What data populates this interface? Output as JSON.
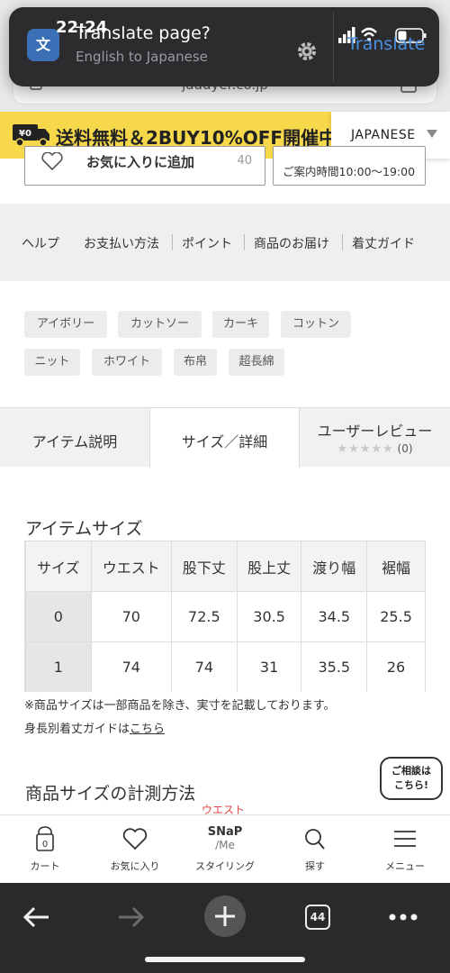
{
  "status_bar": {
    "time": "22:24"
  },
  "browser": {
    "url": "jaddyer.co.jp",
    "translate_popup": {
      "title": "Translate page?",
      "subtitle": "English to Japanese",
      "action": "Translate"
    },
    "tab_count": "44"
  },
  "promo": {
    "badge": "¥0",
    "text": "送料無料＆2BUY10%OFF開催中",
    "language": "JAPANESE"
  },
  "buttons": {
    "favorite_label": "お気に入りに追加",
    "favorite_count": "40",
    "hours": "ご案内時間10:00〜19:00"
  },
  "help_nav": [
    "ヘルプ",
    "お支払い方法",
    "ポイント",
    "商品のお届け",
    "着丈ガイド"
  ],
  "tags": [
    "アイボリー",
    "カットソー",
    "カーキ",
    "コットン",
    "ニット",
    "ホワイト",
    "布帛",
    "超長綿"
  ],
  "tabs": {
    "item_description": "アイテム説明",
    "size_details": "サイズ／詳細",
    "user_review": "ユーザーレビュー",
    "stars": "★★★★★",
    "review_count": "(0)"
  },
  "size_section": {
    "title": "アイテムサイズ",
    "headers": [
      "サイズ",
      "ウエスト",
      "股下丈",
      "股上丈",
      "渡り幅",
      "裾幅"
    ],
    "rows": [
      [
        "0",
        "70",
        "72.5",
        "30.5",
        "34.5",
        "25.5"
      ],
      [
        "1",
        "74",
        "74",
        "31",
        "35.5",
        "26"
      ]
    ],
    "note": "※商品サイズは一部商品を除き、実寸を記載しております。",
    "guide_prefix": "身長別着丈ガイドは",
    "guide_link": "こちら"
  },
  "measure_section": {
    "title": "商品サイズの計測方法",
    "diagram_label": "ウエスト"
  },
  "consult": {
    "line1": "ご相談は",
    "line2": "こちら!"
  },
  "site_nav": {
    "cart": "カート",
    "cart_count": "0",
    "favorites": "お気に入り",
    "styling": "スタイリング",
    "snap_logo_top": "SNaP",
    "snap_logo_bottom": "∕Me",
    "search": "探す",
    "menu": "メニュー"
  },
  "colors": {
    "promo_yellow": "#f6d84a",
    "link_blue": "#4a90e2",
    "safari_dark": "#2a2a2a"
  }
}
